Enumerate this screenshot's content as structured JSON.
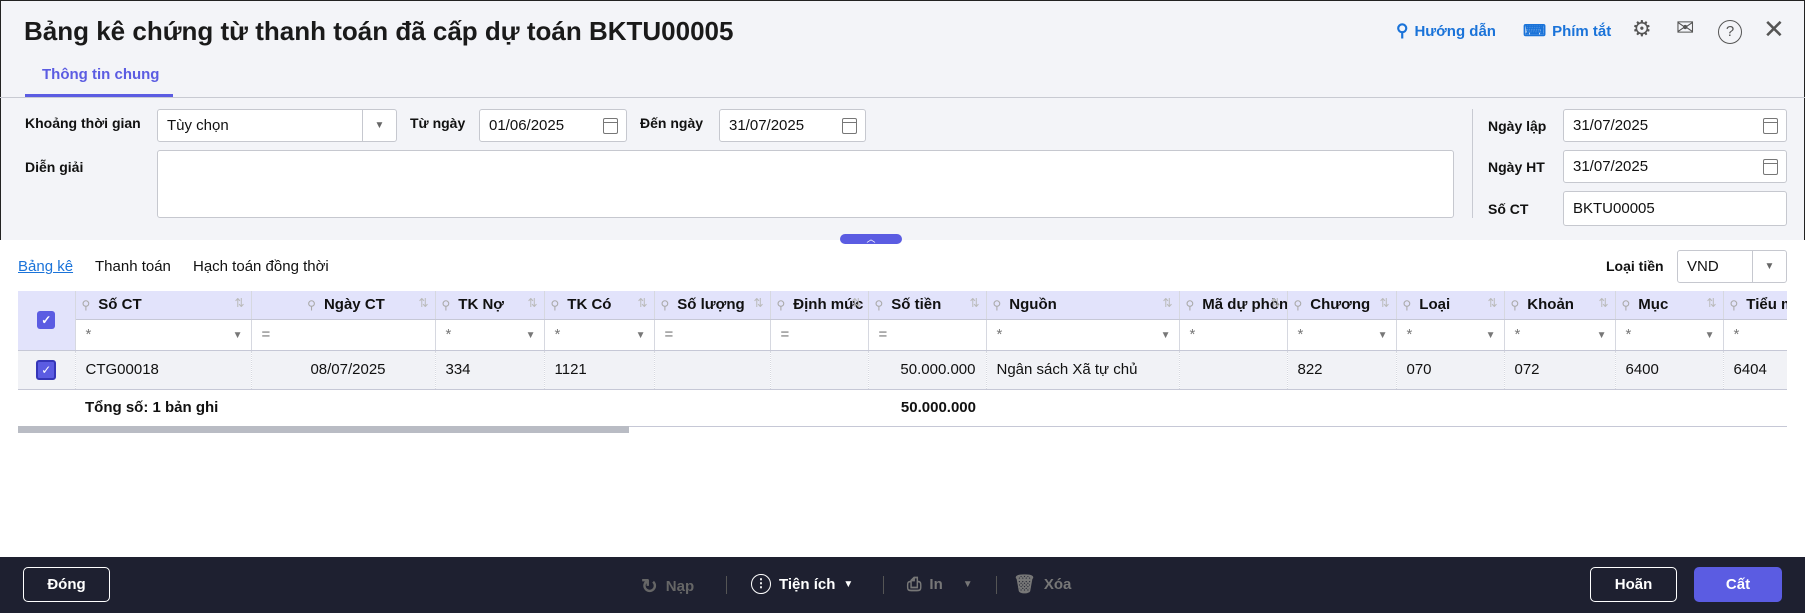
{
  "header": {
    "title": "Bảng kê chứng từ thanh toán đã cấp dự toán BKTU00005",
    "guide_label": "Hướng dẫn",
    "shortcut_label": "Phím tắt"
  },
  "tabs": [
    {
      "label": "Thông tin chung",
      "active": true
    }
  ],
  "form": {
    "period_label": "Khoảng thời gian",
    "period_value": "Tùy chọn",
    "from_label": "Từ ngày",
    "from_value": "01/06/2025",
    "to_label": "Đến ngày",
    "to_value": "31/07/2025",
    "desc_label": "Diễn giải",
    "desc_value": "",
    "created_label": "Ngày lập",
    "created_value": "31/07/2025",
    "posting_label": "Ngày HT",
    "posting_value": "31/07/2025",
    "docno_label": "Số CT",
    "docno_value": "BKTU00005"
  },
  "subtabs": [
    {
      "label": "Bảng kê",
      "active": true
    },
    {
      "label": "Thanh toán"
    },
    {
      "label": "Hạch toán đồng thời"
    }
  ],
  "currency": {
    "label": "Loại tiền",
    "value": "VND"
  },
  "grid": {
    "columns": [
      "Số CT",
      "Ngày CT",
      "TK Nợ",
      "TK Có",
      "Số lượng",
      "Định mức",
      "Số tiền",
      "Nguồn",
      "Mã dự phòng",
      "Chương",
      "Loại",
      "Khoản",
      "Mục",
      "Tiểu mục"
    ],
    "filters": [
      "*",
      "=",
      "*",
      "*",
      "=",
      "=",
      "=",
      "*",
      "*",
      "*",
      "*",
      "*",
      "*",
      "*"
    ],
    "rows": [
      {
        "checked": true,
        "cells": [
          "CTG00018",
          "08/07/2025",
          "334",
          "1121",
          "",
          "",
          "50.000.000",
          "Ngân sách Xã tự chủ",
          "",
          "822",
          "070",
          "072",
          "6400",
          "6404"
        ]
      }
    ],
    "total_label": "Tổng số: 1 bản ghi",
    "total_amount": "50.000.000"
  },
  "footer": {
    "close": "Đóng",
    "reload": "Nạp",
    "utilities": "Tiện ích",
    "print": "In",
    "delete": "Xóa",
    "postpone": "Hoãn",
    "save": "Cất"
  },
  "colors": {
    "accent": "#5b5ce2",
    "footer_bg": "#1e2030",
    "link": "#1a73d9"
  }
}
